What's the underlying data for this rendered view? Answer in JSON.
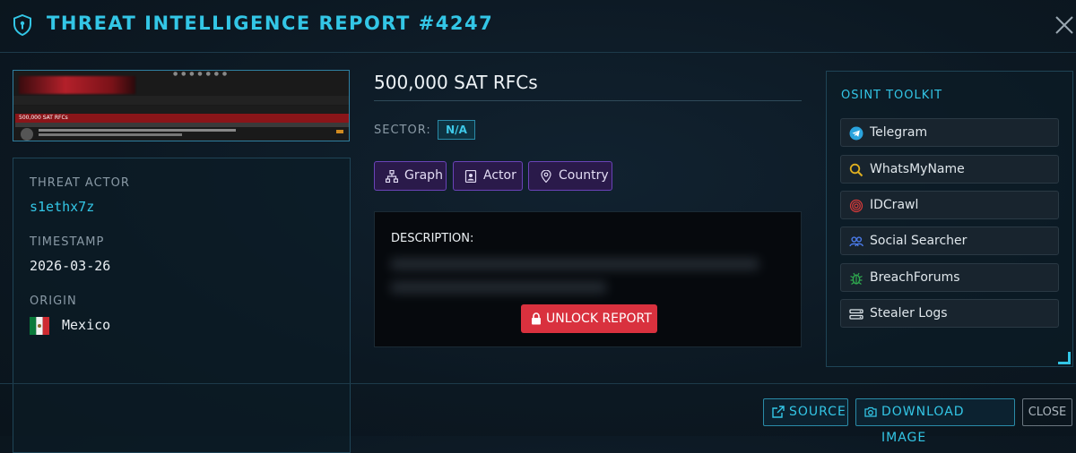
{
  "header": {
    "title": "THREAT INTELLIGENCE REPORT #4247",
    "icon": "shield-icon",
    "accent": "#33c6e6"
  },
  "thumbnail": {
    "post_title": "500,000 SAT RFCs"
  },
  "details": {
    "actor_label": "THREAT ACTOR",
    "actor_value": "s1ethx7z",
    "timestamp_label": "TIMESTAMP",
    "timestamp_value": "2026-03-26",
    "origin_label": "ORIGIN",
    "origin_value": "Mexico",
    "origin_flag": "mexico-flag-icon"
  },
  "report": {
    "title": "500,000 SAT RFCs",
    "sector_label": "SECTOR:",
    "sector_value": "N/A",
    "actions": [
      {
        "label": "Graph",
        "icon": "graph-icon"
      },
      {
        "label": "Actor",
        "icon": "id-badge-icon"
      },
      {
        "label": "Country",
        "icon": "map-pin-icon"
      }
    ],
    "description_label": "DESCRIPTION:",
    "unlock_label": "UNLOCK REPORT",
    "unlock_color": "#d9313e"
  },
  "osint": {
    "title": "OSINT TOOLKIT",
    "tools": [
      {
        "label": "Telegram",
        "icon": "telegram-icon"
      },
      {
        "label": "WhatsMyName",
        "icon": "search-icon"
      },
      {
        "label": "IDCrawl",
        "icon": "fingerprint-icon"
      },
      {
        "label": "Social Searcher",
        "icon": "users-icon"
      },
      {
        "label": "BreachForums",
        "icon": "bug-icon"
      },
      {
        "label": "Stealer Logs",
        "icon": "server-icon"
      }
    ]
  },
  "footer": {
    "source_label": "SOURCE",
    "download_label": "DOWNLOAD IMAGE",
    "close_label": "CLOSE"
  }
}
